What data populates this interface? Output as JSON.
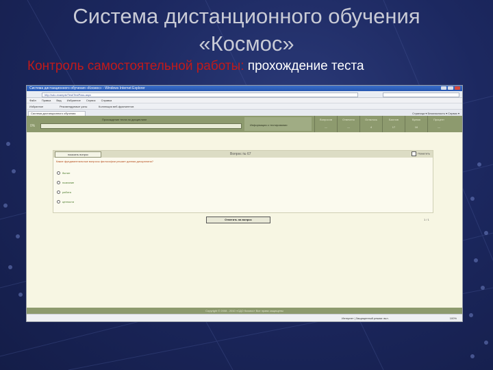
{
  "slide": {
    "title_line1": "Система дистанционного обучения",
    "title_line2": "«Космос»",
    "subtitle_red": "Контроль самостоятельной работы:",
    "subtitle_white": " прохождение теста"
  },
  "browser": {
    "window_title": "Система дистанционного обучения «Космос» - Windows Internet Explorer",
    "address": "http://sdo.example/Test/TestPass.aspx",
    "menu_items": [
      "Файл",
      "Правка",
      "Вид",
      "Избранное",
      "Сервис",
      "Справка"
    ],
    "fav_items": [
      "Избранное",
      "Рекомендуемые узлы",
      "Коллекция веб-фрагментов"
    ],
    "tab_label": "Система дистанционного обучения",
    "tools": "Страница ▾  Безопасность ▾  Сервис ▾"
  },
  "test": {
    "left_num": "0%",
    "header_label": "Прохождение теста по дисциплине",
    "info_label": "Информация о тестировании",
    "columns": [
      {
        "h": "Вопросов",
        "v": "—"
      },
      {
        "h": "Отвечено",
        "v": "—"
      },
      {
        "h": "Осталось",
        "v": "4"
      },
      {
        "h": "Баллов",
        "v": "17"
      },
      {
        "h": "Время",
        "v": "16"
      },
      {
        "h": "Процент",
        "v": "—"
      }
    ],
    "show_question_button": "показать вопрос",
    "question_number": "Вопрос № 67",
    "flag_label": "Пометить",
    "question_text": "Какие фундаментальные вопросы философии решает данная дисциплина?",
    "options": [
      "бытие",
      "познание",
      "работа",
      "ценности"
    ],
    "answer_button": "Ответить на вопрос",
    "pager": "1 / 1"
  },
  "footer": {
    "text": "Copyright © 2008 - 2010 «СДО Космос»  Все права защищены"
  },
  "status": {
    "zone": "Интернет | Защищенный режим: вкл.",
    "zoom": "100%"
  },
  "colors": {
    "slide_bg": "#1c2860",
    "title": "#c9cbd6",
    "subtitle_accent": "#c21a1a",
    "test_header": "#8d9a6e",
    "page_bg": "#f7f6e3"
  }
}
